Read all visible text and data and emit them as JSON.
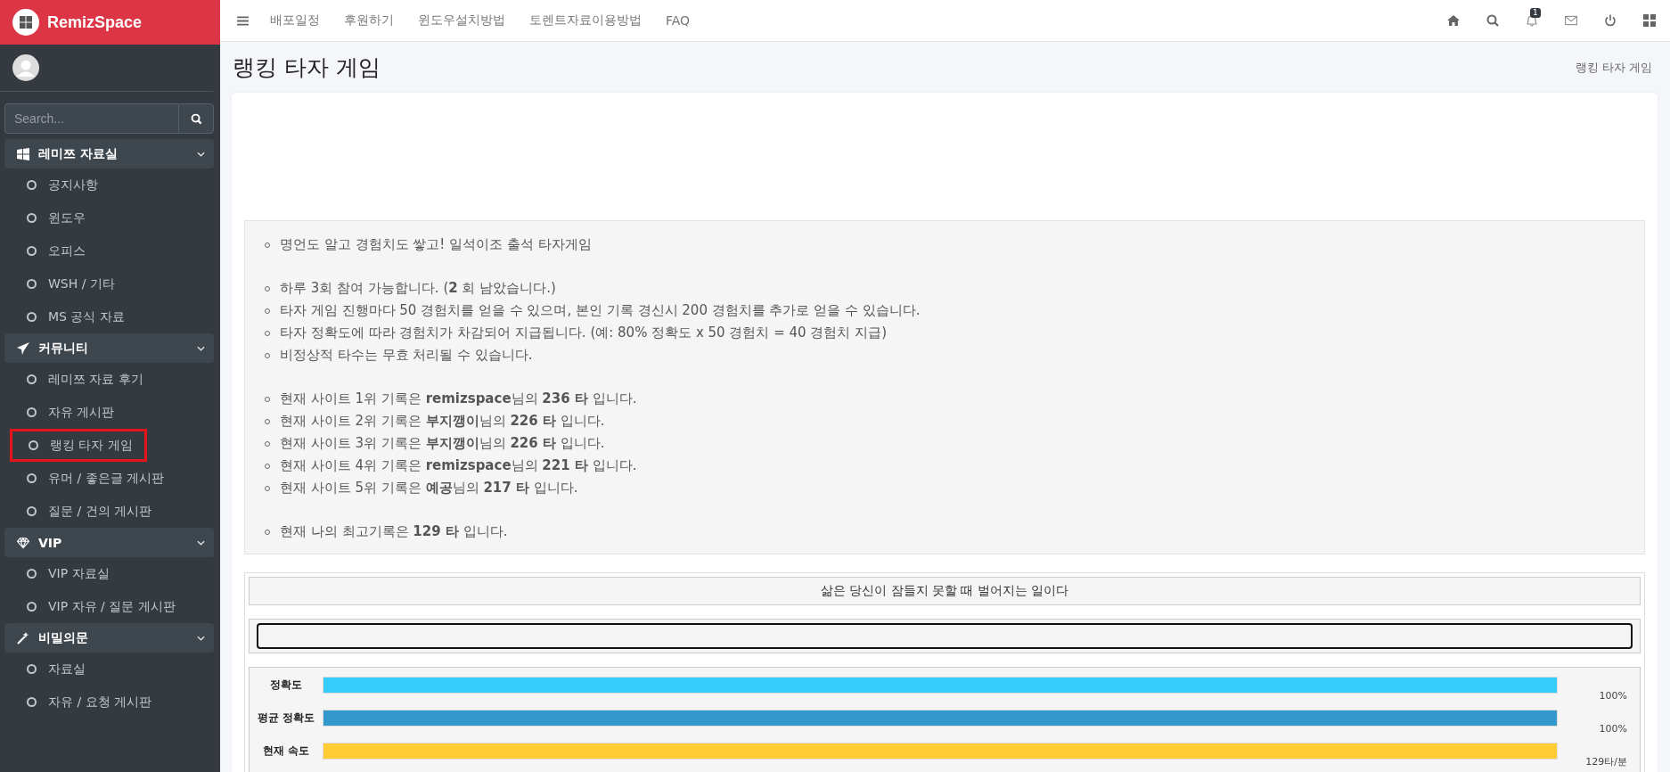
{
  "brand": {
    "name": "RemizSpace"
  },
  "search": {
    "placeholder": "Search..."
  },
  "sidebar": {
    "groups": [
      {
        "label": "레미쯔 자료실",
        "items": [
          {
            "label": "공지사항",
            "selected": false
          },
          {
            "label": "윈도우",
            "selected": false
          },
          {
            "label": "오피스",
            "selected": false
          },
          {
            "label": "WSH / 기타",
            "selected": false
          },
          {
            "label": "MS 공식 자료",
            "selected": false
          }
        ]
      },
      {
        "label": "커뮤니티",
        "items": [
          {
            "label": "레미쯔 자료 후기",
            "selected": false
          },
          {
            "label": "자유 게시판",
            "selected": false
          },
          {
            "label": "랭킹 타자 게임",
            "selected": true
          },
          {
            "label": "유머 / 좋은글 게시판",
            "selected": false
          },
          {
            "label": "질문 / 건의 게시판",
            "selected": false
          }
        ]
      },
      {
        "label": "VIP",
        "items": [
          {
            "label": "VIP 자료실",
            "selected": false
          },
          {
            "label": "VIP 자유 / 질문 게시판",
            "selected": false
          }
        ]
      },
      {
        "label": "비밀의문",
        "items": [
          {
            "label": "자료실",
            "selected": false
          },
          {
            "label": "자유 / 요청 게시판",
            "selected": false
          }
        ]
      }
    ]
  },
  "topnav": {
    "links": [
      "배포일정",
      "후원하기",
      "윈도우설치방법",
      "토렌트자료이용방법",
      "FAQ"
    ],
    "notification_count": "1"
  },
  "page": {
    "title": "랭킹 타자 게임",
    "breadcrumb": "랭킹 타자 게임"
  },
  "info": [
    [
      "명언도 알고 경험치도 쌓고! 일석이조 출석 타자게임"
    ],
    [
      "하루 3회 참여 가능합니다. (**2** 회 남았습니다.)",
      "타자 게임 진행마다 50 경험치를 얻을 수 있으며, 본인 기록 경신시 200 경험치를 추가로 얻을 수 있습니다.",
      "타자 정확도에 따라 경험치가 차감되어 지급됩니다. (예: 80% 정확도 x 50 경험치 = 40 경험치 지급)",
      "비정상적 타수는 무효 처리될 수 있습니다."
    ],
    [
      "현재 사이트 1위 기록은 **remizspace**님의 **236 타** 입니다.",
      "현재 사이트 2위 기록은 **부지깽이**님의 **226 타** 입니다.",
      "현재 사이트 3위 기록은 **부지깽이**님의 **226 타** 입니다.",
      "현재 사이트 4위 기록은 **remizspace**님의 **221 타** 입니다.",
      "현재 사이트 5위 기록은 **예공**님의 **217 타** 입니다."
    ],
    [
      "현재 나의 최고기록은 **129 타** 입니다."
    ]
  ],
  "game": {
    "sentence": "삶은 당신이 잠들지 못할 때 벌어지는 일이다",
    "meters": [
      {
        "label": "정확도",
        "level": 1,
        "reading": "100%",
        "color": "#35ccfb"
      },
      {
        "label": "평균 정확도",
        "level": 1,
        "reading": "100%",
        "color": "#3399cc"
      },
      {
        "label": "현재 속도",
        "level": 1,
        "reading": "129타/분",
        "color": "#ffcc33"
      }
    ]
  }
}
